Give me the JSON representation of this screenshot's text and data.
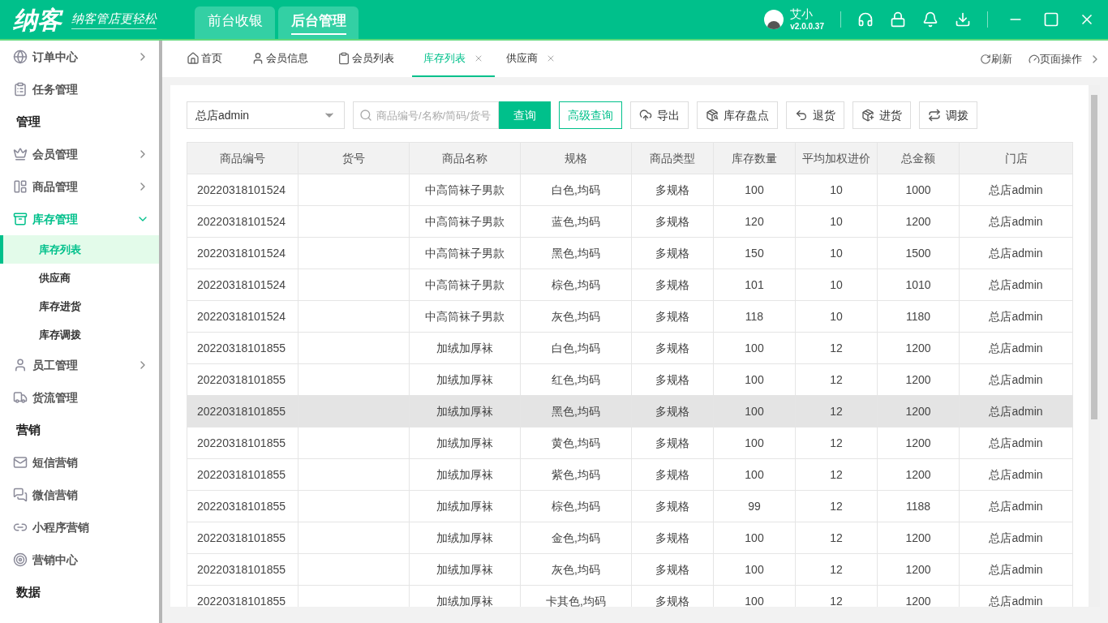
{
  "header": {
    "logo": "纳客",
    "slogan": "纳客管店更轻松",
    "tabs": [
      {
        "label": "前台收银",
        "selected": false
      },
      {
        "label": "后台管理",
        "selected": true
      }
    ],
    "user": {
      "name": "艾小",
      "version": "v2.0.0.37"
    }
  },
  "sidebar": {
    "items": [
      {
        "kind": "group",
        "label": "订单中心",
        "expanded": false
      },
      {
        "kind": "link",
        "label": "任务管理"
      },
      {
        "kind": "section",
        "label": "管理"
      },
      {
        "kind": "group",
        "label": "会员管理",
        "expanded": false
      },
      {
        "kind": "group",
        "label": "商品管理",
        "expanded": false
      },
      {
        "kind": "group",
        "label": "库存管理",
        "expanded": true
      },
      {
        "kind": "sub",
        "label": "库存列表",
        "selected": true
      },
      {
        "kind": "sub",
        "label": "供应商",
        "selected": false
      },
      {
        "kind": "sub",
        "label": "库存进货",
        "selected": false
      },
      {
        "kind": "sub",
        "label": "库存调拨",
        "selected": false
      },
      {
        "kind": "group",
        "label": "员工管理",
        "expanded": false
      },
      {
        "kind": "link",
        "label": "货流管理"
      },
      {
        "kind": "section",
        "label": "营销"
      },
      {
        "kind": "link",
        "label": "短信营销"
      },
      {
        "kind": "link",
        "label": "微信营销"
      },
      {
        "kind": "link",
        "label": "小程序营销"
      },
      {
        "kind": "link",
        "label": "营销中心"
      },
      {
        "kind": "section",
        "label": "数据"
      }
    ]
  },
  "page_tabs": {
    "tabs": [
      {
        "label": "首页",
        "selected": false,
        "closable": false
      },
      {
        "label": "会员信息",
        "selected": false,
        "closable": false
      },
      {
        "label": "会员列表",
        "selected": false,
        "closable": false
      },
      {
        "label": "库存列表",
        "selected": true,
        "closable": true
      },
      {
        "label": "供应商",
        "selected": false,
        "closable": true
      }
    ],
    "actions": [
      "刷新",
      "页面操作"
    ]
  },
  "toolbar": {
    "store": "总店admin",
    "search_placeholder": "商品编号/名称/简码/货号",
    "query": "查询",
    "advanced_query": "高级查询",
    "buttons": [
      "导出",
      "库存盘点",
      "退货",
      "进货",
      "调拨"
    ]
  },
  "table": {
    "columns": [
      "商品编号",
      "货号",
      "商品名称",
      "规格",
      "商品类型",
      "库存数量",
      "平均加权进价",
      "总金额",
      "门店"
    ],
    "rows": [
      {
        "cells": [
          "20220318101524",
          "",
          "中高筒袜子男款",
          "白色,均码",
          "多规格",
          "100",
          "10",
          "1000",
          "总店admin"
        ],
        "selected": false
      },
      {
        "cells": [
          "20220318101524",
          "",
          "中高筒袜子男款",
          "蓝色,均码",
          "多规格",
          "120",
          "10",
          "1200",
          "总店admin"
        ],
        "selected": false
      },
      {
        "cells": [
          "20220318101524",
          "",
          "中高筒袜子男款",
          "黑色,均码",
          "多规格",
          "150",
          "10",
          "1500",
          "总店admin"
        ],
        "selected": false
      },
      {
        "cells": [
          "20220318101524",
          "",
          "中高筒袜子男款",
          "棕色,均码",
          "多规格",
          "101",
          "10",
          "1010",
          "总店admin"
        ],
        "selected": false
      },
      {
        "cells": [
          "20220318101524",
          "",
          "中高筒袜子男款",
          "灰色,均码",
          "多规格",
          "118",
          "10",
          "1180",
          "总店admin"
        ],
        "selected": false
      },
      {
        "cells": [
          "20220318101855",
          "",
          "加绒加厚袜",
          "白色,均码",
          "多规格",
          "100",
          "12",
          "1200",
          "总店admin"
        ],
        "selected": false
      },
      {
        "cells": [
          "20220318101855",
          "",
          "加绒加厚袜",
          "红色,均码",
          "多规格",
          "100",
          "12",
          "1200",
          "总店admin"
        ],
        "selected": false
      },
      {
        "cells": [
          "20220318101855",
          "",
          "加绒加厚袜",
          "黑色,均码",
          "多规格",
          "100",
          "12",
          "1200",
          "总店admin"
        ],
        "selected": true
      },
      {
        "cells": [
          "20220318101855",
          "",
          "加绒加厚袜",
          "黄色,均码",
          "多规格",
          "100",
          "12",
          "1200",
          "总店admin"
        ],
        "selected": false
      },
      {
        "cells": [
          "20220318101855",
          "",
          "加绒加厚袜",
          "紫色,均码",
          "多规格",
          "100",
          "12",
          "1200",
          "总店admin"
        ],
        "selected": false
      },
      {
        "cells": [
          "20220318101855",
          "",
          "加绒加厚袜",
          "棕色,均码",
          "多规格",
          "99",
          "12",
          "1188",
          "总店admin"
        ],
        "selected": false
      },
      {
        "cells": [
          "20220318101855",
          "",
          "加绒加厚袜",
          "金色,均码",
          "多规格",
          "100",
          "12",
          "1200",
          "总店admin"
        ],
        "selected": false
      },
      {
        "cells": [
          "20220318101855",
          "",
          "加绒加厚袜",
          "灰色,均码",
          "多规格",
          "100",
          "12",
          "1200",
          "总店admin"
        ],
        "selected": false
      },
      {
        "cells": [
          "20220318101855",
          "",
          "加绒加厚袜",
          "卡其色,均码",
          "多规格",
          "100",
          "12",
          "1200",
          "总店admin"
        ],
        "selected": false
      }
    ]
  }
}
